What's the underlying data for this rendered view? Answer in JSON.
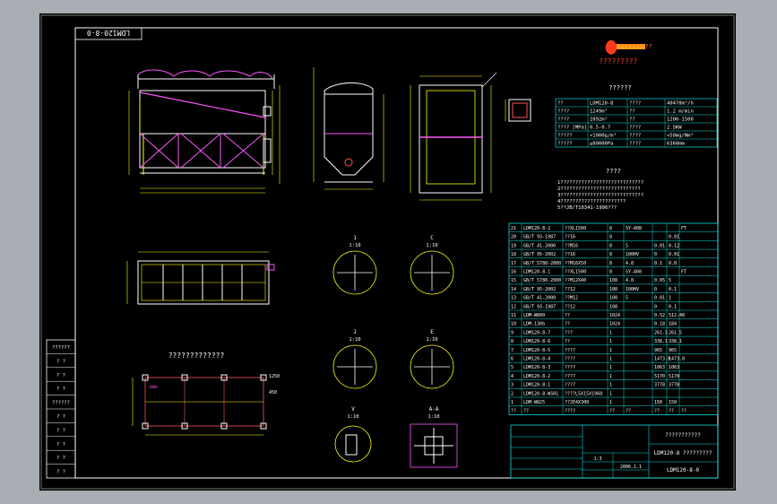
{
  "drawing": {
    "stamp": "LDM120-8-0",
    "logo_text": "?????????",
    "logo_subtext": "?????????",
    "detail_labels": {
      "d1_num": "1",
      "d1_scale": "1:10",
      "d2_num": "C",
      "d2_scale": "1:10",
      "d3_num": "J",
      "d3_scale": "1:10",
      "d4_num": "E",
      "d4_scale": "1:10",
      "d5_num": "V",
      "d5_scale": "1:10",
      "d6_num": "A-A",
      "d6_scale": "1:10"
    },
    "plan_title": "?????????????",
    "plan_labels": [
      "1000",
      "1250",
      "450"
    ]
  },
  "specs": {
    "title": "??????",
    "rows": [
      [
        "??",
        "LDM120-8",
        "????",
        "40470m³/h"
      ],
      [
        "????",
        "1249m²",
        "??",
        "1.2 m/min"
      ],
      [
        "????",
        "1092m²",
        "??",
        "1200-1500"
      ],
      [
        "???? [MPa]",
        "0.5-0.7",
        "????",
        "2.5KW"
      ],
      [
        "?????",
        "<1000g/m³",
        "????",
        "<50mg/Nm³"
      ],
      [
        "?????",
        "≥80000Pa",
        "????",
        "6360mm"
      ]
    ]
  },
  "notes": {
    "title": "????",
    "lines": [
      "1????????????????????????????",
      "2???????????????????????????",
      "3????????????????????????????",
      "4??????????????????????",
      "5??JB/T10341-1996???"
    ]
  },
  "bom": [
    [
      "21",
      "LDM120-8-2",
      "??XL1500",
      "8",
      "SY-A08",
      "",
      "",
      "FT"
    ],
    [
      "20",
      "GB/T 93-1987",
      "??16",
      "8",
      "",
      "",
      "0.01",
      ""
    ],
    [
      "19",
      "GB/T 41-2000",
      "??M16",
      "8",
      "5",
      "0.01",
      "0.12",
      ""
    ],
    [
      "18",
      "GB/T 95-2002",
      "??16",
      "8",
      "100HV",
      "0",
      "0.01",
      ""
    ],
    [
      "17",
      "GB/T 5780-2000",
      "??M16X50",
      "8",
      "4.8",
      "0.1",
      "0.8",
      ""
    ],
    [
      "16",
      "LDM120-8-1",
      "??XL1500",
      "8",
      "SY-A08",
      "",
      "",
      "FT"
    ],
    [
      "15",
      "GB/T 5780-2000",
      "??M12X40",
      "108",
      "4.8",
      "0.05",
      "5",
      ""
    ],
    [
      "14",
      "GB/T 95-2002",
      "??12",
      "108",
      "100HV",
      "0",
      "0.1",
      ""
    ],
    [
      "13",
      "GB/T 41-2000",
      "??M12",
      "108",
      "5",
      "0.01",
      "1",
      ""
    ],
    [
      "12",
      "GB/T 93-1987",
      "??12",
      "108",
      "",
      "0",
      "0.1",
      ""
    ],
    [
      "11",
      "LDM-W800",
      "??",
      "1024",
      "",
      "0.52",
      "512.48",
      ""
    ],
    [
      "10",
      "LDM-130b",
      "??",
      "1024",
      "",
      "0.18",
      "184",
      ""
    ],
    [
      "9",
      "LDM120-8-7",
      "???",
      "1",
      "",
      "261.5",
      "261.5",
      ""
    ],
    [
      "8",
      "LDM120-8-6",
      "??",
      "1",
      "",
      "338.1",
      "338.1",
      ""
    ],
    [
      "7",
      "LDM120-8-5",
      "????",
      "1",
      "",
      "965",
      "965",
      ""
    ],
    [
      "6",
      "LDM120-8-4",
      "????",
      "1",
      "",
      "1473.8",
      "1473.8",
      ""
    ],
    [
      "5",
      "LDM120-8-3",
      "????",
      "1",
      "",
      "1063",
      "1063",
      ""
    ],
    [
      "4",
      "LDM120-8-2",
      "????",
      "1",
      "",
      "5170",
      "5170",
      ""
    ],
    [
      "3",
      "LDM120-8-1",
      "????",
      "1",
      "",
      "3778",
      "3778",
      ""
    ],
    [
      "2",
      "LDM120-8-WS01",
      "????L5X15X1968",
      "1",
      "",
      "",
      "",
      ""
    ],
    [
      "1",
      "LDM-W825",
      "??2E4X300",
      "1",
      "",
      "150",
      "150",
      ""
    ],
    [
      "??",
      "??",
      "????",
      "??",
      "??",
      "??",
      "??",
      "??"
    ]
  ],
  "title_block": {
    "company": "???????????",
    "drawing_name": "LDM120-8 ?????????",
    "drawing_no": "LDM120-8-0",
    "scale_label": "1:3",
    "sheet_label": "2006.1.1",
    "date_label": "2006.1.1"
  },
  "side_block": [
    "??????",
    "? ?",
    "? ?",
    "? ?",
    "??????",
    "? ?",
    "? ?",
    "? ?",
    "? ?",
    "? ?"
  ]
}
